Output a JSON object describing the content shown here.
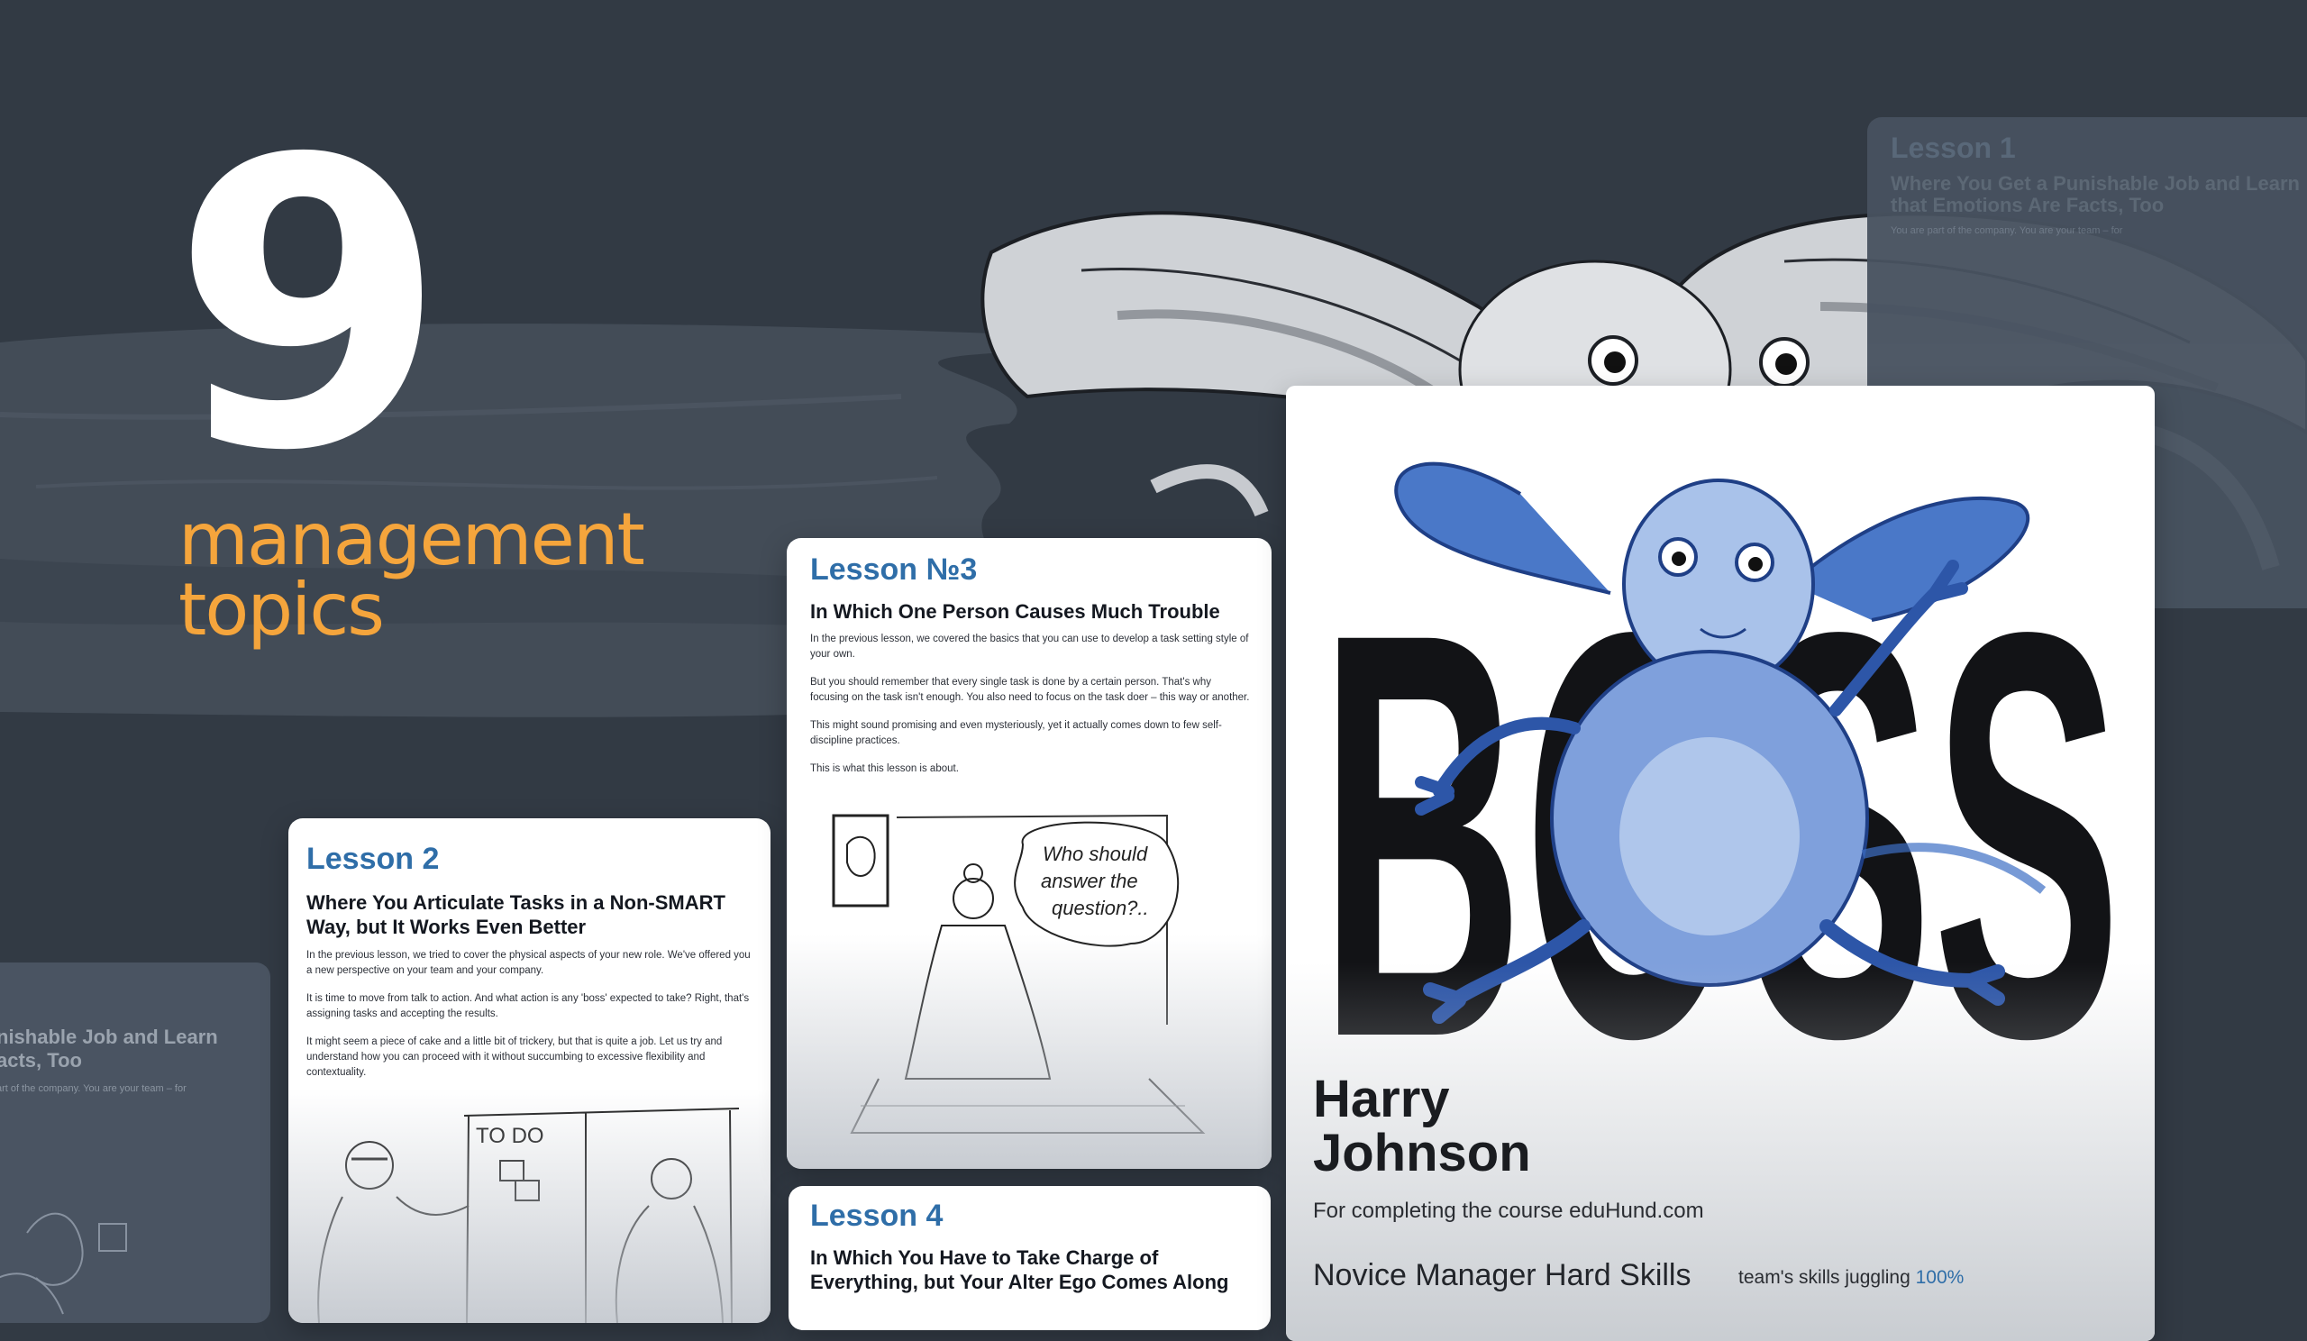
{
  "hero": {
    "number": "9",
    "subtitle_line1": "management",
    "subtitle_line2": "topics"
  },
  "lessons": [
    {
      "label": "Lesson 1",
      "title": "Where You Get a Punishable Job and Learn that Emotions Are Facts, Too",
      "excerpt": "You are part of the company. You are your team – for"
    },
    {
      "label": "Lesson 2",
      "title": "Where You Articulate Tasks in a Non-SMART Way, but It Works Even Better",
      "paragraphs": [
        "In the previous lesson, we tried to cover the physical aspects of your new role. We've offered you a new perspective on your team and your company.",
        "It is time to move from talk to action. And what action is any 'boss' expected to take? Right, that's assigning tasks and accepting the results.",
        "It might seem a piece of cake and a little bit of trickery, but that is quite a job. Let us try and understand how you can proceed with it without succumbing to excessive flexibility and contextuality."
      ],
      "sketch_text": "TO DO"
    },
    {
      "label": "Lesson №3",
      "title": "In Which One Person Causes Much Trouble",
      "paragraphs": [
        "In the previous lesson, we covered the basics that you can use to develop a task setting style of your own.",
        "But you should remember that every single task is done by a certain person. That's why focusing on the task isn't enough. You also need to focus on the task doer – this way or another.",
        "This might sound promising and even mysteriously, yet it actually comes down to few self-discipline practices.",
        "This is what this lesson is about."
      ],
      "speech_bubble": [
        "Who should",
        "answer the",
        "question?.."
      ]
    },
    {
      "label": "Lesson 4",
      "title": "In Which You Have to Take Charge of Everything, but Your Alter Ego Comes Along"
    }
  ],
  "ghost_left": {
    "title": "nishable Job and Learn acts, Too",
    "excerpt": "art of the company. You are your team – for"
  },
  "certificate": {
    "big_word": "BOSS",
    "first_name": "Harry",
    "last_name": "Johnson",
    "course_line": "For completing the course eduHund.com",
    "course_name": "Novice Manager Hard Skills",
    "skill_label": "team's skills juggling",
    "skill_value": "100%"
  },
  "colors": {
    "background": "#323a44",
    "accent_orange": "#f5a53c",
    "lesson_blue": "#2f6ea8",
    "creature_blue": "#3d6fc4"
  },
  "icons": [
    "creature-illustration",
    "gray-creature-illustration",
    "todo-board-sketch",
    "teacher-sketch"
  ]
}
